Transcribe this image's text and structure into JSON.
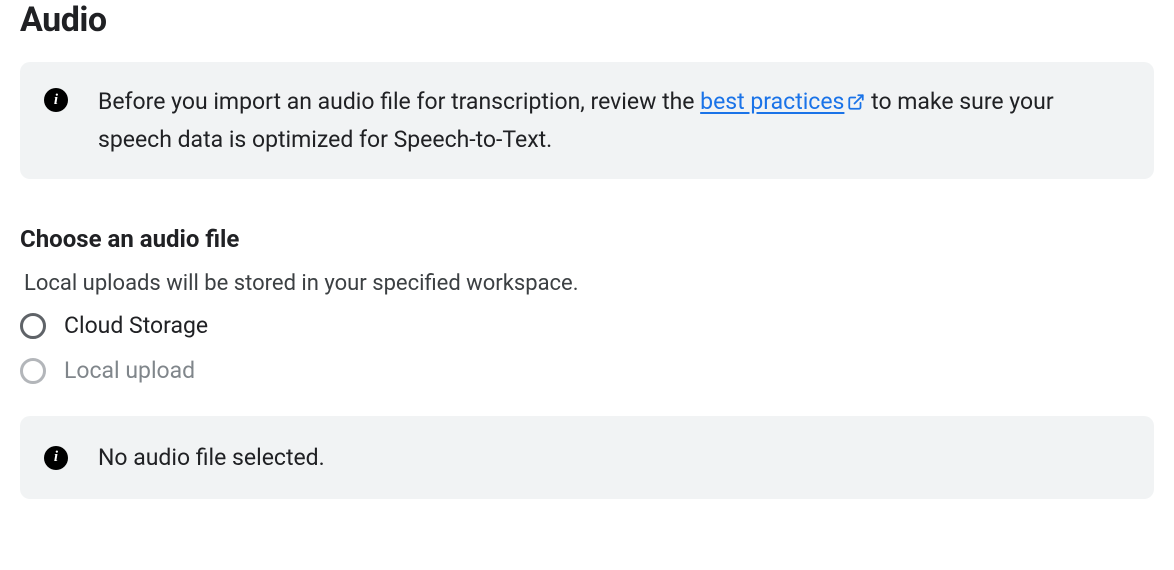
{
  "title": "Audio",
  "infobox": {
    "text_before_link": "Before you import an audio file for transcription, review the ",
    "link_text": "best practices",
    "text_after_link": " to make sure your speech data is optimized for Speech-to-Text."
  },
  "section": {
    "heading": "Choose an audio file",
    "helper_text": "Local uploads will be stored in your specified workspace."
  },
  "radio": {
    "options": [
      {
        "label": "Cloud Storage",
        "enabled": true
      },
      {
        "label": "Local upload",
        "enabled": false
      }
    ]
  },
  "status": {
    "text": "No audio file selected."
  }
}
